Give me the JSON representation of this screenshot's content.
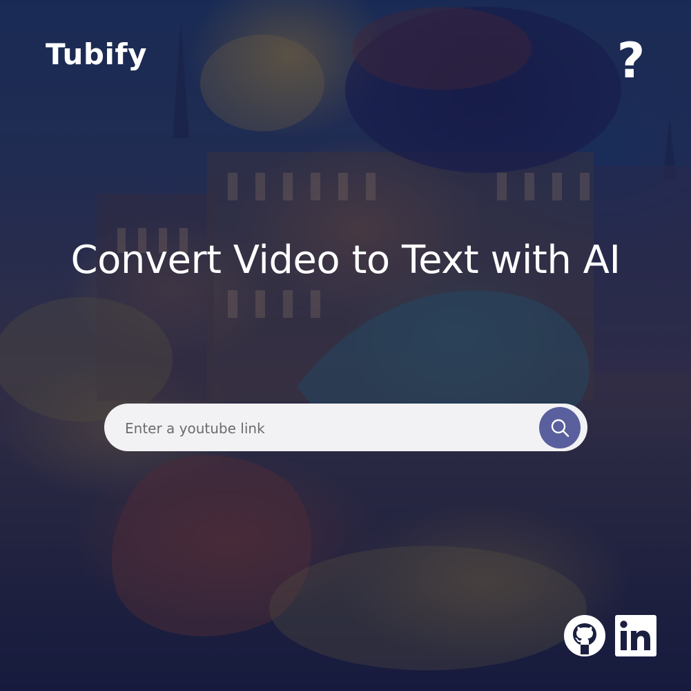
{
  "header": {
    "logo_text": "Tubify",
    "help_label": "?"
  },
  "hero": {
    "headline": "Convert Video to Text with AI"
  },
  "search": {
    "placeholder": "Enter a youtube link",
    "value": "",
    "button_icon": "search-icon"
  },
  "footer": {
    "social_links": [
      "github-icon",
      "linkedin-icon"
    ]
  },
  "colors": {
    "overlay": "#161c48",
    "search_button": "#5a5f9e",
    "search_field": "#f2f2f4",
    "text": "#ffffff"
  }
}
